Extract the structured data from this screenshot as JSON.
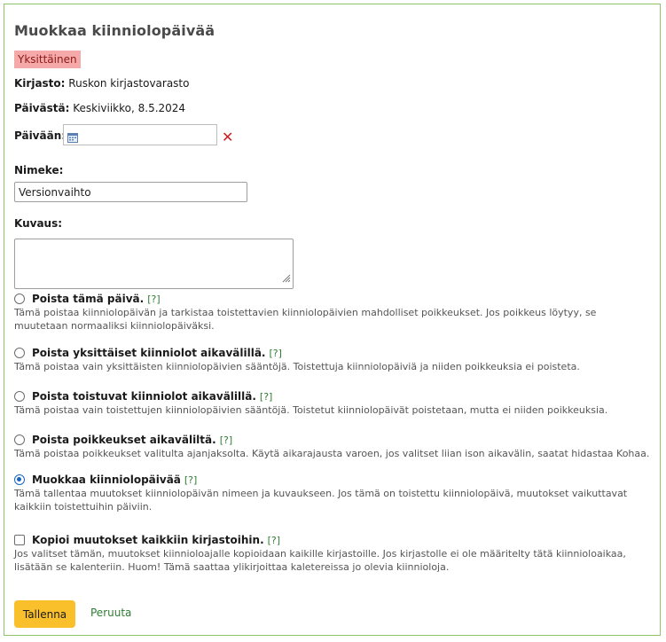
{
  "title": "Muokkaa kiinniolopäivää",
  "badge": "Yksittäinen",
  "library": {
    "label": "Kirjasto:",
    "value": "Ruskon kirjastovarasto"
  },
  "from_date": {
    "label": "Päivästä:",
    "value": "Keskiviikko, 8.5.2024"
  },
  "to_date": {
    "label": "Päivään:",
    "value": "",
    "clear_symbol": "✕"
  },
  "name": {
    "label": "Nimeke:",
    "value": "Versionvaihto"
  },
  "description": {
    "label": "Kuvaus:",
    "value": ""
  },
  "help_text": "[?]",
  "options": [
    {
      "title": "Poista tämä päivä.",
      "desc": "Tämä poistaa kiinniolopäivän ja tarkistaa toistettavien kiinniolopäivien mahdolliset poikkeukset. Jos poikkeus löytyy, se muutetaan normaaliksi kiinniolopäiväksi.",
      "checked": false
    },
    {
      "title": "Poista yksittäiset kiinniolot aikavälillä.",
      "desc": "Tämä poistaa vain yksittäisten kiinniolopäivien sääntöjä. Toistettuja kiinniolopäiviä ja niiden poikkeuksia ei poisteta.",
      "checked": false
    },
    {
      "title": "Poista toistuvat kiinniolot aikavälillä.",
      "desc": "Tämä poistaa vain toistettujen kiinniolopäivien sääntöjä. Toistetut kiinniolopäivät poistetaan, mutta ei niiden poikkeuksia.",
      "checked": false
    },
    {
      "title": "Poista poikkeukset aikaväliltä.",
      "desc": "Tämä poistaa poikkeukset valitulta ajanjaksolta. Käytä aikarajausta varoen, jos valitset liian ison aikavälin, saatat hidastaa Kohaa.",
      "checked": false
    },
    {
      "title": "Muokkaa kiinniolopäivää",
      "desc": "Tämä tallentaa muutokset kiinniolopäivän nimeen ja kuvaukseen. Jos tämä on toistettu kiinniolopäivä, muutokset vaikuttavat kaikkiin toistettuihin päiviin.",
      "checked": true
    }
  ],
  "copy_all": {
    "title": "Kopioi muutokset kaikkiin kirjastoihin.",
    "desc": "Jos valitset tämän, muutokset kiinnioloajalle kopioidaan kaikille kirjastoille. Jos kirjastolle ei ole määritelty tätä kiinnioloaikaa, lisätään se kalenteriin. Huom! Tämä saattaa ylikirjoittaa kaletereissa jo olevia kiinnioloja.",
    "checked": false
  },
  "buttons": {
    "save": "Tallenna",
    "cancel": "Peruuta"
  },
  "colors": {
    "accent_border": "#8fc46a",
    "badge_bg": "#f5a9a9",
    "save_bg": "#f9c02b",
    "link": "#2e7d32",
    "radio_checked": "#1565c0"
  },
  "icons": {
    "date_input": "calendar-icon",
    "clear": "close-icon"
  }
}
